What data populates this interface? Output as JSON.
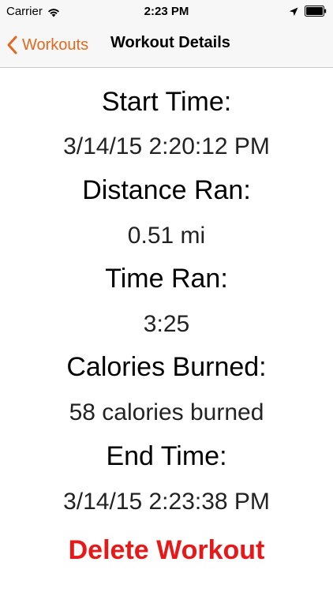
{
  "status_bar": {
    "carrier": "Carrier",
    "time": "2:23 PM"
  },
  "nav": {
    "back_label": "Workouts",
    "title": "Workout Details",
    "accent_color": "#e26a1f"
  },
  "details": {
    "start_time_label": "Start Time:",
    "start_time_value": "3/14/15 2:20:12 PM",
    "distance_label": "Distance Ran:",
    "distance_value": "0.51 mi",
    "time_ran_label": "Time Ran:",
    "time_ran_value": "3:25",
    "calories_label": "Calories Burned:",
    "calories_value": "58 calories burned",
    "end_time_label": "End Time:",
    "end_time_value": "3/14/15 2:23:38 PM"
  },
  "actions": {
    "delete_label": "Delete Workout",
    "delete_color": "#e81818"
  },
  "icons": {
    "wifi": "wifi-icon",
    "location": "location-arrow-icon",
    "battery": "battery-icon",
    "back": "chevron-left-icon"
  }
}
